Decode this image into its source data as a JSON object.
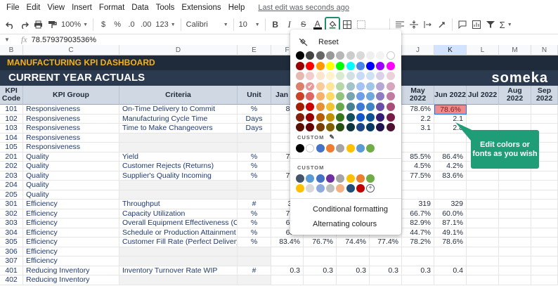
{
  "menu": [
    "File",
    "Edit",
    "View",
    "Insert",
    "Format",
    "Data",
    "Tools",
    "Extensions",
    "Help"
  ],
  "last_edit": "Last edit was seconds ago",
  "toolbar": {
    "zoom": "100%",
    "currency": "$",
    "percent": "%",
    "dec_less": ".0",
    "dec_more": ".00",
    "more_formats": "123",
    "font": "Calibri",
    "font_size": "10",
    "bold": "B",
    "italic": "I",
    "strike": "S",
    "text_color": "A"
  },
  "formula": {
    "cell_ref": "",
    "value": "78.57937903536%"
  },
  "columns": [
    "B",
    "C",
    "D",
    "E",
    "F",
    "J",
    "K",
    "L",
    "M",
    "N"
  ],
  "banner": {
    "title": "MANUFACTURING KPI DASHBOARD",
    "subtitle": "CURRENT YEAR ACTUALS",
    "logo": "someka"
  },
  "headers": {
    "code": "KPI Code",
    "group": "KPI Group",
    "criteria": "Criteria",
    "unit": "Unit",
    "jan": "Jan 20",
    "may": "May 2022",
    "jun": "Jun 2022",
    "jul": "Jul 2022",
    "aug": "Aug 2022",
    "sep": "Sep 2022"
  },
  "rows": [
    {
      "code": "101",
      "group": "Responsiveness",
      "criteria": "On-Time Delivery to Commit",
      "unit": "%",
      "jan": "83.0",
      "c1": "",
      "c2": "",
      "c3": "",
      "may": "78.6%",
      "jun": "78.6%"
    },
    {
      "code": "102",
      "group": "Responsiveness",
      "criteria": "Manufacturing Cycle Time",
      "unit": "Days",
      "jan": "2.4",
      "c1": "",
      "c2": "",
      "c3": "",
      "may": "2.2",
      "jun": "2.1"
    },
    {
      "code": "103",
      "group": "Responsiveness",
      "criteria": "Time to Make Changeovers",
      "unit": "Days",
      "jan": "3.0",
      "c1": "",
      "c2": "",
      "c3": "",
      "may": "3.1",
      "jun": "2.8"
    },
    {
      "code": "104",
      "group": "Responsiveness",
      "criteria": "",
      "unit": "",
      "jan": "",
      "c1": "",
      "c2": "",
      "c3": "",
      "may": "",
      "jun": ""
    },
    {
      "code": "105",
      "group": "Responsiveness",
      "criteria": "",
      "unit": "",
      "jan": "",
      "c1": "",
      "c2": "",
      "c3": "",
      "may": "",
      "jun": ""
    },
    {
      "code": "201",
      "group": "Quality",
      "criteria": "Yield",
      "unit": "%",
      "jan": "74.5",
      "c1": "",
      "c2": "",
      "c3": "",
      "may": "85.5%",
      "jun": "86.4%"
    },
    {
      "code": "202",
      "group": "Quality",
      "criteria": "Customer Rejects (Returns)",
      "unit": "%",
      "jan": "3.9",
      "c1": "",
      "c2": "",
      "c3": "",
      "may": "4.5%",
      "jun": "4.2%"
    },
    {
      "code": "203",
      "group": "Quality",
      "criteria": "Supplier's Quality Incoming",
      "unit": "%",
      "jan": "79.2",
      "c1": "",
      "c2": "",
      "c3": "",
      "may": "77.5%",
      "jun": "83.6%"
    },
    {
      "code": "204",
      "group": "Quality",
      "criteria": "",
      "unit": "",
      "jan": "",
      "c1": "",
      "c2": "",
      "c3": "",
      "may": "",
      "jun": ""
    },
    {
      "code": "205",
      "group": "Quality",
      "criteria": "",
      "unit": "",
      "jan": "",
      "c1": "",
      "c2": "",
      "c3": "",
      "may": "",
      "jun": ""
    },
    {
      "code": "301",
      "group": "Efficiency",
      "criteria": "Throughput",
      "unit": "#",
      "jan": "393",
      "c1": "",
      "c2": "",
      "c3": "",
      "may": "319",
      "jun": "329"
    },
    {
      "code": "302",
      "group": "Efficiency",
      "criteria": "Capacity Utilization",
      "unit": "%",
      "jan": "75.9",
      "c1": "",
      "c2": "",
      "c3": "",
      "may": "66.7%",
      "jun": "60.0%"
    },
    {
      "code": "303",
      "group": "Efficiency",
      "criteria": "Overall Equipment Effectiveness (OEE)",
      "unit": "%",
      "jan": "67.1",
      "c1": "",
      "c2": "",
      "c3": "",
      "may": "82.9%",
      "jun": "87.1%"
    },
    {
      "code": "304",
      "group": "Efficiency",
      "criteria": "Schedule or Production Attainment",
      "unit": "%",
      "jan": "63.1",
      "c1": "",
      "c2": "",
      "c3": "",
      "may": "44.7%",
      "jun": "49.1%"
    },
    {
      "code": "305",
      "group": "Efficiency",
      "criteria": "Customer Fill Rate (Perfect Delivery %)",
      "unit": "%",
      "jan": "83.4%",
      "c1": "76.7%",
      "c2": "74.4%",
      "c3": "77.4%",
      "may": "78.2%",
      "jun": "78.6%"
    },
    {
      "code": "306",
      "group": "Efficiency",
      "criteria": "",
      "unit": "",
      "jan": "",
      "c1": "",
      "c2": "",
      "c3": "",
      "may": "",
      "jun": ""
    },
    {
      "code": "307",
      "group": "Efficiency",
      "criteria": "",
      "unit": "",
      "jan": "",
      "c1": "",
      "c2": "",
      "c3": "",
      "may": "",
      "jun": ""
    },
    {
      "code": "401",
      "group": "Reducing Inventory",
      "criteria": "Inventory Turnover Rate WIP",
      "unit": "#",
      "jan": "0.3",
      "c1": "0.3",
      "c2": "0.3",
      "c3": "0.3",
      "may": "0.3",
      "jun": "0.4"
    },
    {
      "code": "402",
      "group": "Reducing Inventory",
      "criteria": "",
      "unit": "",
      "jan": "",
      "c1": "",
      "c2": "",
      "c3": "",
      "may": "",
      "jun": ""
    }
  ],
  "palette": {
    "reset": "Reset",
    "custom1": "CUSTOM",
    "custom2": "CUSTOM",
    "conditional": "Conditional formatting",
    "alternating": "Alternating colours",
    "standard_colors": [
      [
        "#000000",
        "#434343",
        "#666666",
        "#999999",
        "#b7b7b7",
        "#cccccc",
        "#d9d9d9",
        "#efefef",
        "#f3f3f3",
        "#ffffff"
      ],
      [
        "#980000",
        "#ff0000",
        "#ff9900",
        "#ffff00",
        "#00ff00",
        "#00ffff",
        "#4a86e8",
        "#0000ff",
        "#9900ff",
        "#ff00ff"
      ],
      [
        "#e6b8af",
        "#f4cccc",
        "#fce5cd",
        "#fff2cc",
        "#d9ead3",
        "#d0e0e3",
        "#c9daf8",
        "#cfe2f3",
        "#d9d2e9",
        "#ead1dc"
      ],
      [
        "#dd7e6b",
        "#ea9999",
        "#f9cb9c",
        "#ffe599",
        "#b6d7a8",
        "#a2c4c9",
        "#a4c2f4",
        "#9fc5e8",
        "#b4a7d6",
        "#d5a6bd"
      ],
      [
        "#cc4125",
        "#e06666",
        "#f6b26b",
        "#ffd966",
        "#93c47d",
        "#76a5af",
        "#6d9eeb",
        "#6fa8dc",
        "#8e7cc3",
        "#c27ba0"
      ],
      [
        "#a61c00",
        "#cc0000",
        "#e69138",
        "#f1c232",
        "#6aa84f",
        "#45818e",
        "#3c78d8",
        "#3d85c6",
        "#674ea7",
        "#a64d79"
      ],
      [
        "#85200c",
        "#990000",
        "#b45f06",
        "#bf9000",
        "#38761d",
        "#134f5c",
        "#1155cc",
        "#0b5394",
        "#351c75",
        "#741b47"
      ],
      [
        "#5b0f00",
        "#660000",
        "#783f04",
        "#7f6000",
        "#274e13",
        "#0c343d",
        "#1c4587",
        "#073763",
        "#20124d",
        "#4c1130"
      ]
    ],
    "custom_row1": [
      "#000000",
      "#ffffff",
      "#4472c4",
      "#ed7d31",
      "#a5a5a5",
      "#ffc000",
      "#5b9bd5",
      "#70ad47"
    ],
    "custom_row2a": [
      "#44546a",
      "#5b9bd5",
      "#4472c4",
      "#7030a0",
      "#a5a5a5",
      "#ffc000",
      "#ed7d31",
      "#70ad47"
    ],
    "custom_row2b": [
      "#ffc000",
      "#d9d9d9",
      "#8faadc",
      "#bfbfbf",
      "#f4b183",
      "#1f4e79",
      "#c00000"
    ],
    "checked_color": "#ea9999"
  },
  "callout": "Edit colors or fonts as you wish"
}
